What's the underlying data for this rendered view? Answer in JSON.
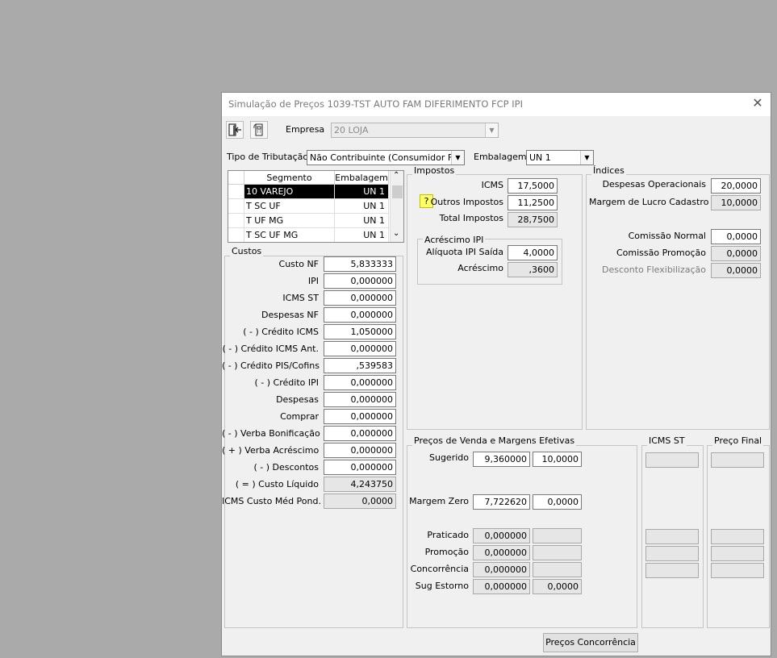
{
  "window": {
    "title": "Simulação de Preços  1039-TST AUTO FAM DIFERIMENTO FCP IPI",
    "close_glyph": "✕"
  },
  "toolbar": {
    "empresa_label": "Empresa",
    "empresa_value": "20 LOJA"
  },
  "tributacao": {
    "label": "Tipo de Tributação",
    "value": "Não Contribuinte (Consumidor Final)",
    "embalagem_label": "Embalagem",
    "embalagem_value": "UN  1"
  },
  "segment_grid": {
    "headers": [
      "Segmento",
      "Embalagem"
    ],
    "rows": [
      {
        "segmento": "10 VAREJO",
        "embalagem": "UN  1"
      },
      {
        "segmento": "T SC UF",
        "embalagem": "UN  1"
      },
      {
        "segmento": "T  UF MG",
        "embalagem": "UN  1"
      },
      {
        "segmento": "T  SC UF MG",
        "embalagem": "UN  1"
      }
    ]
  },
  "custos": {
    "title": "Custos",
    "rows": [
      {
        "label": "Custo NF",
        "value": "5,833333"
      },
      {
        "label": "IPI",
        "value": "0,000000"
      },
      {
        "label": "ICMS ST",
        "value": "0,000000"
      },
      {
        "label": "Despesas NF",
        "value": "0,000000"
      },
      {
        "label": "( - ) Crédito ICMS",
        "value": "1,050000"
      },
      {
        "label": "( - ) Crédito ICMS Ant.",
        "value": "0,000000"
      },
      {
        "label": "( - ) Crédito PIS/Cofins",
        "value": ",539583"
      },
      {
        "label": "( - ) Crédito IPI",
        "value": "0,000000"
      },
      {
        "label": "Despesas",
        "value": "0,000000"
      },
      {
        "label": "Comprar",
        "value": "0,000000"
      },
      {
        "label": "( - ) Verba Bonificação",
        "value": "0,000000"
      },
      {
        "label": "( + ) Verba Acréscimo",
        "value": "0,000000"
      },
      {
        "label": "( - ) Descontos",
        "value": "0,000000"
      },
      {
        "label": "( = ) Custo Líquido",
        "value": "4,243750"
      },
      {
        "label": "ICMS Custo Méd Pond.",
        "value": "0,0000"
      }
    ]
  },
  "impostos": {
    "title": "Impostos",
    "icms_label": "ICMS",
    "icms_value": "17,5000",
    "outros_label": "Outros Impostos",
    "outros_value": "11,2500",
    "total_label": "Total Impostos",
    "total_value": "28,7500",
    "help_glyph": "?",
    "acrescimo_ipi": {
      "title": "Acréscimo IPI",
      "aliquota_label": "Alíquota IPI Saída",
      "aliquota_value": "4,0000",
      "acrescimo_label": "Acréscimo",
      "acrescimo_value": ",3600"
    }
  },
  "indices": {
    "title": "Índices",
    "despesas_label": "Despesas Operacionais",
    "despesas_value": "20,0000",
    "margem_label": "Margem de Lucro Cadastro",
    "margem_value": "10,0000",
    "comissao_normal_label": "Comissão Normal",
    "comissao_normal_value": "0,0000",
    "comissao_promo_label": "Comissão Promoção",
    "comissao_promo_value": "0,0000",
    "desconto_flex_label": "Desconto Flexibilização",
    "desconto_flex_value": "0,0000"
  },
  "precos": {
    "title": "Preços de Venda e Margens Efetivas",
    "sugerido_label": "Sugerido",
    "sugerido_preco": "9,360000",
    "sugerido_margem": "10,0000",
    "margem_zero_label": "Margem Zero",
    "margem_zero_preco": "7,722620",
    "margem_zero_margem": "0,0000",
    "praticado_label": "Praticado",
    "praticado_preco": "0,000000",
    "praticado_margem": "",
    "promocao_label": "Promoção",
    "promocao_preco": "0,000000",
    "promocao_margem": "",
    "concorrencia_label": "Concorrência",
    "concorrencia_preco": "0,000000",
    "concorrencia_margem": "",
    "sug_estorno_label": "Sug Estorno",
    "sug_estorno_preco": "0,000000",
    "sug_estorno_margem": "0,0000"
  },
  "icms_st": {
    "title": "ICMS ST"
  },
  "preco_final": {
    "title": "Preço Final"
  },
  "buttons": {
    "precos_concorrencia": "Preços Concorrência"
  }
}
